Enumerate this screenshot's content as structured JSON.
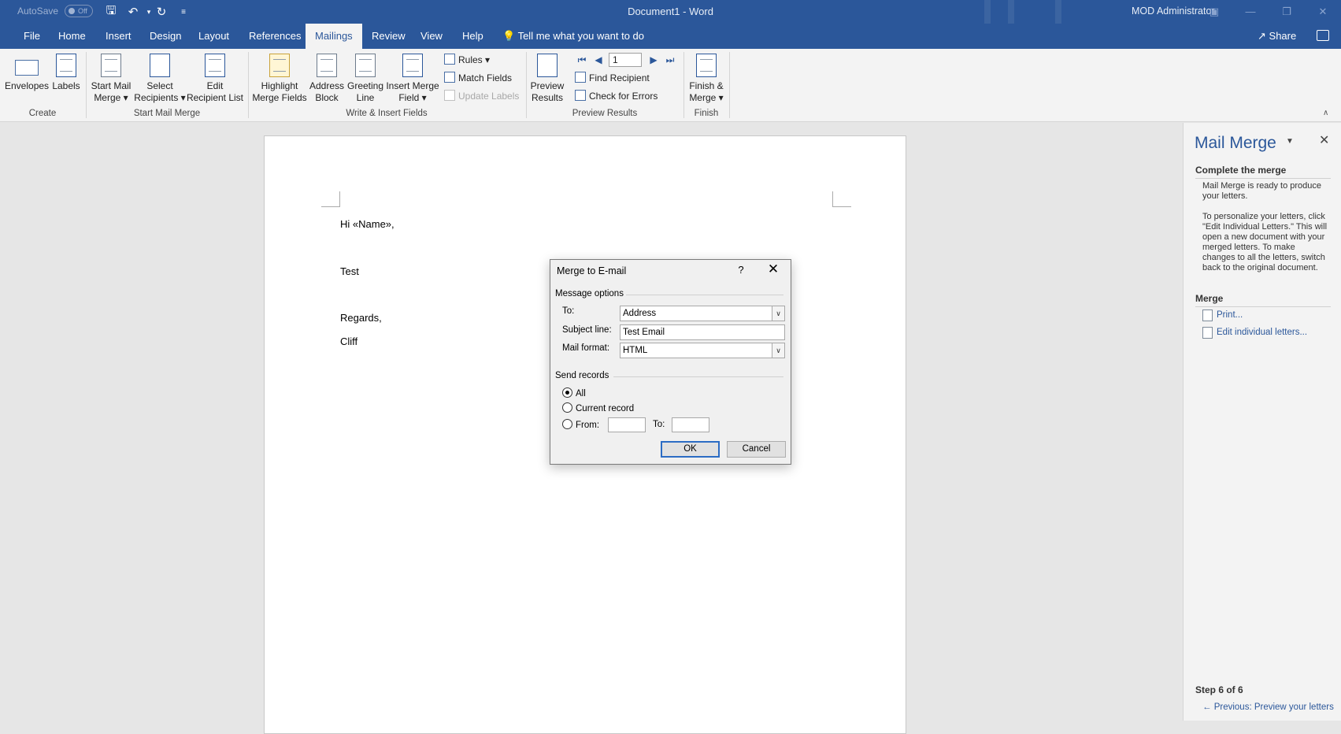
{
  "titlebar": {
    "autosave_label": "AutoSave",
    "autosave_state": "Off",
    "doc_title": "Document1  -  Word",
    "user_name": "MOD Administrator",
    "icons": [
      "save-icon",
      "undo-icon",
      "redo-icon",
      "customize-qat-icon"
    ]
  },
  "tabs": [
    {
      "label": "File"
    },
    {
      "label": "Home"
    },
    {
      "label": "Insert"
    },
    {
      "label": "Design"
    },
    {
      "label": "Layout"
    },
    {
      "label": "References"
    },
    {
      "label": "Mailings",
      "active": true
    },
    {
      "label": "Review"
    },
    {
      "label": "View"
    },
    {
      "label": "Help"
    }
  ],
  "tell_me": "Tell me what you want to do",
  "share": "Share",
  "ribbon": {
    "create": {
      "label": "Create",
      "envelopes": "Envelopes",
      "labels": "Labels"
    },
    "start": {
      "label": "Start Mail Merge",
      "start_mail_merge_1": "Start Mail",
      "start_mail_merge_2": "Merge ▾",
      "select_recipients_1": "Select",
      "select_recipients_2": "Recipients ▾",
      "edit_list_1": "Edit",
      "edit_list_2": "Recipient List"
    },
    "write": {
      "label": "Write & Insert Fields",
      "highlight_1": "Highlight",
      "highlight_2": "Merge Fields",
      "address_1": "Address",
      "address_2": "Block",
      "greeting_1": "Greeting",
      "greeting_2": "Line",
      "insert_field_1": "Insert Merge",
      "insert_field_2": "Field ▾",
      "rules": "Rules ▾",
      "match_fields": "Match Fields",
      "update_labels": "Update Labels"
    },
    "preview": {
      "label": "Preview Results",
      "preview_1": "Preview",
      "preview_2": "Results",
      "record": "1",
      "find_recipient": "Find Recipient",
      "check_errors": "Check for Errors"
    },
    "finish": {
      "label": "Finish",
      "finish_1": "Finish &",
      "finish_2": "Merge ▾"
    }
  },
  "document": {
    "line1": "Hi «Name»,",
    "line2": "Test",
    "line3": "Regards,",
    "line4": "Cliff"
  },
  "dialog": {
    "title": "Merge to E-mail",
    "help": "?",
    "message_options": "Message options",
    "to_label": "To:",
    "to_value": "Address",
    "subject_label": "Subject line:",
    "subject_value": "Test Email",
    "format_label": "Mail format:",
    "format_value": "HTML",
    "send_records": "Send records",
    "all": "All",
    "current_record": "Current record",
    "from": "From:",
    "to2": "To:",
    "ok": "OK",
    "cancel": "Cancel"
  },
  "pane": {
    "title": "Mail Merge",
    "heading1": "Complete the merge",
    "para1": "Mail Merge is ready to produce your letters.",
    "para2": "To personalize your letters, click \"Edit Individual Letters.\" This will open a new document with your merged letters. To make changes to all the letters, switch back to the original document.",
    "heading2": "Merge",
    "print": "Print...",
    "edit_letters": "Edit individual letters...",
    "step": "Step 6 of 6",
    "previous": "Previous: Preview your letters"
  }
}
